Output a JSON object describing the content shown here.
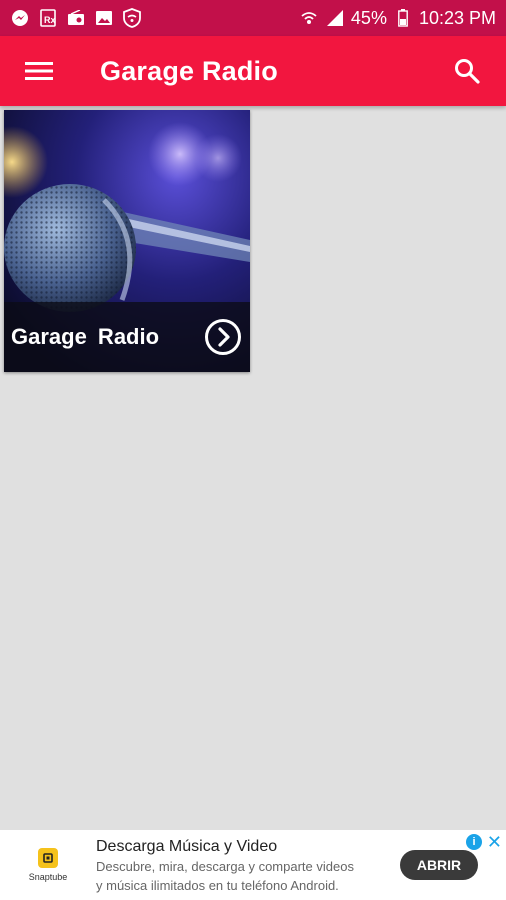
{
  "status_bar": {
    "battery": "45%",
    "time": "10:23 PM",
    "icons": [
      "messenger-icon",
      "rx-icon",
      "radio-icon",
      "image-icon",
      "shield-wifi-icon",
      "wifi-icon",
      "signal-icon",
      "battery-icon"
    ]
  },
  "app_bar": {
    "title": "Garage Radio",
    "menu_icon": "hamburger-menu-icon",
    "search_icon": "search-icon"
  },
  "card": {
    "title": "Garage  Radio",
    "arrow_icon": "chevron-right-circle-icon"
  },
  "ad": {
    "brand": "Snaptube",
    "title": "Descarga Música y Video",
    "description_line1": "Descubre, mira, descarga y comparte videos",
    "description_line2": "y música ilimitados en tu teléfono Android.",
    "cta": "ABRIR"
  },
  "colors": {
    "status_bar": "#c2104a",
    "app_bar": "#f2163f",
    "background": "#e0e0e0"
  }
}
